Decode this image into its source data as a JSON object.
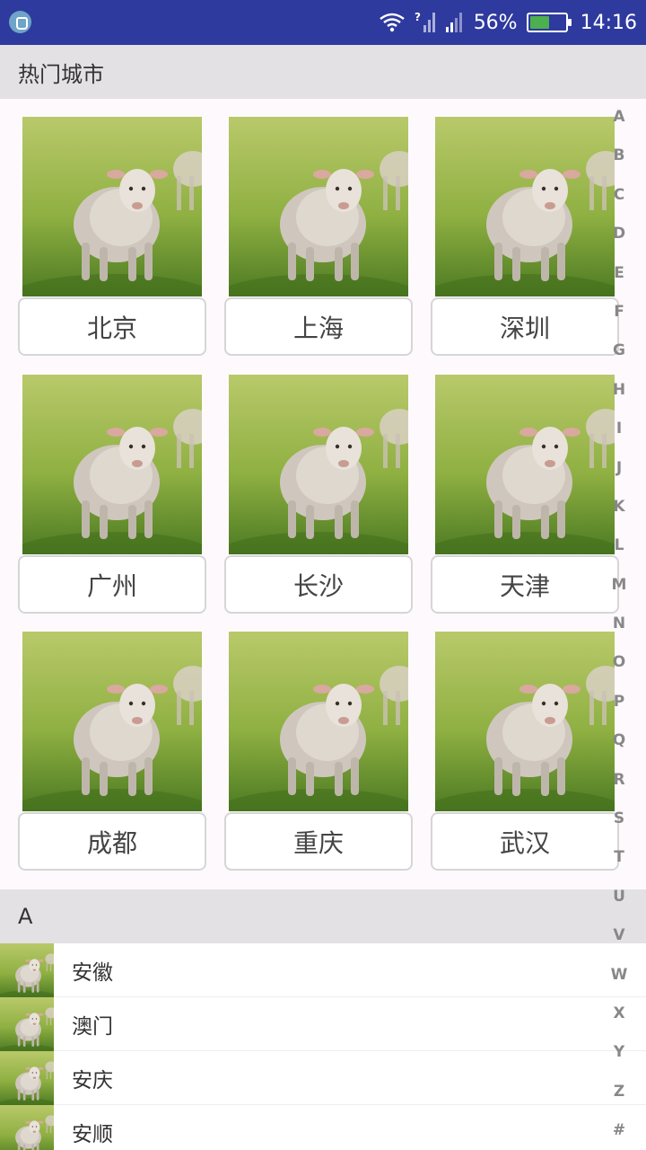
{
  "status_bar": {
    "battery_percent": "56%",
    "battery_level": 0.56,
    "time": "14:16",
    "icons": [
      "app-notification-icon",
      "wifi-icon",
      "signal-unknown-icon",
      "cell-signal-icon",
      "battery-icon"
    ]
  },
  "hot_section": {
    "title": "热门城市",
    "cities": [
      "北京",
      "上海",
      "深圳",
      "广州",
      "长沙",
      "天津",
      "成都",
      "重庆",
      "武汉"
    ]
  },
  "group_a": {
    "header": "A",
    "items": [
      "安徽",
      "澳门",
      "安庆",
      "安顺"
    ]
  },
  "alphabet_index": [
    "A",
    "B",
    "C",
    "D",
    "E",
    "F",
    "G",
    "H",
    "I",
    "J",
    "K",
    "L",
    "M",
    "N",
    "O",
    "P",
    "Q",
    "R",
    "S",
    "T",
    "U",
    "V",
    "W",
    "X",
    "Y",
    "Z",
    "#"
  ],
  "colors": {
    "status_bar": "#2e3a9e",
    "section_header": "#e3e1e4",
    "page_background": "#fdf9fc",
    "index_letter": "#888888"
  }
}
